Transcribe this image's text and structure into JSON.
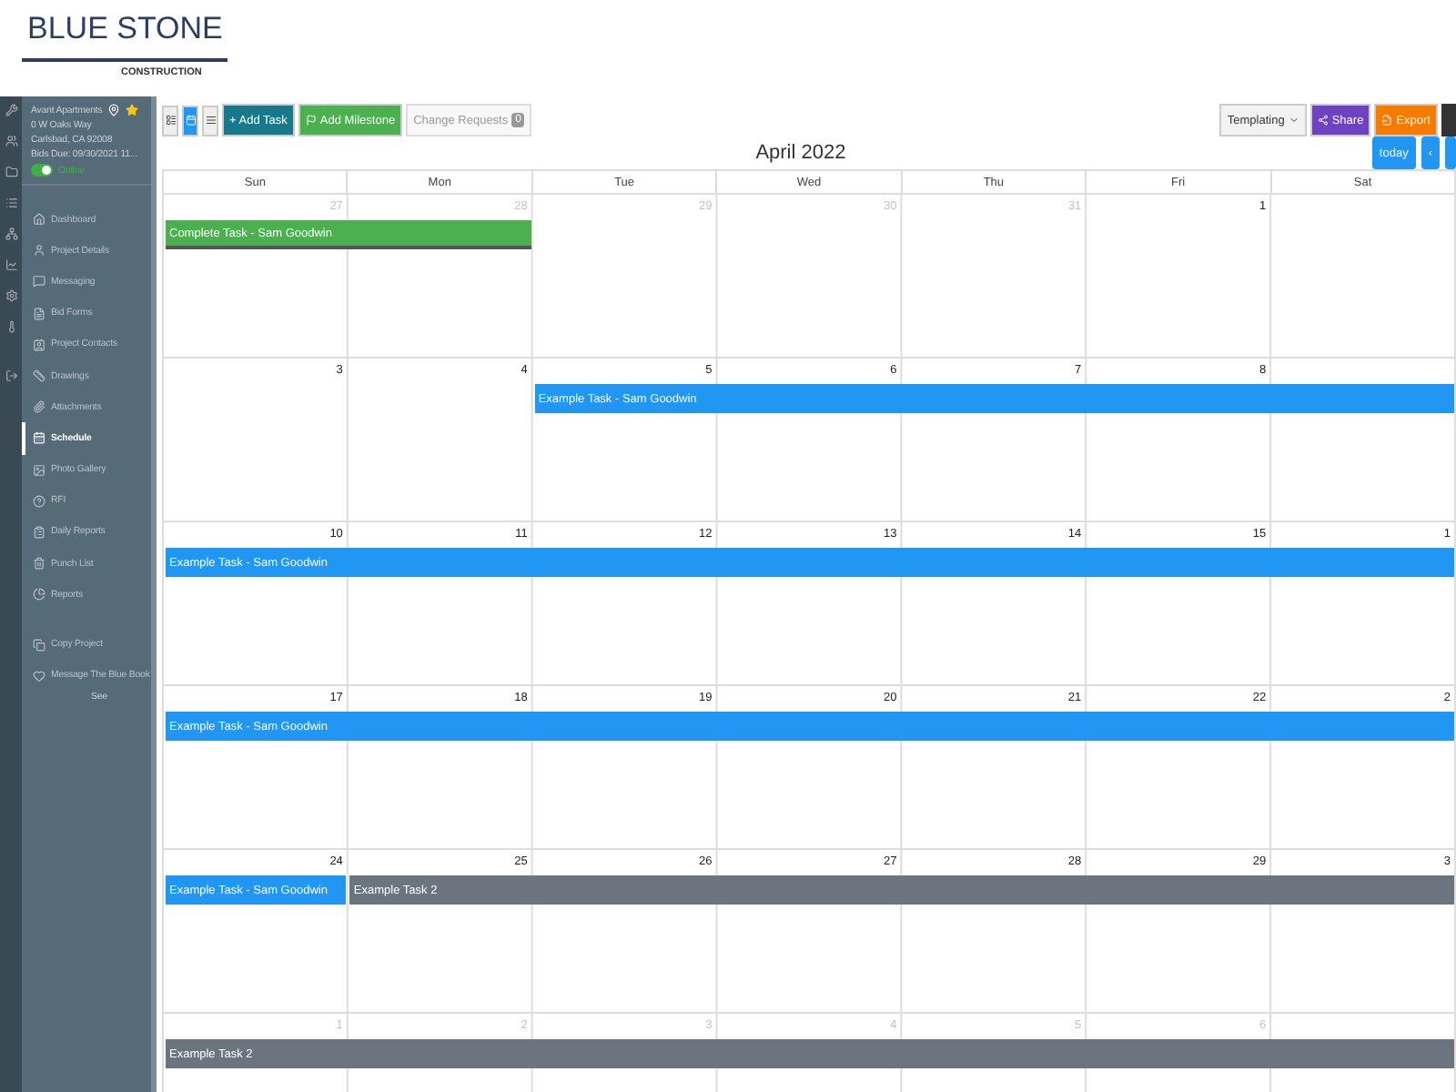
{
  "logo": {
    "name": "BLUE STONE",
    "tagline": "CONSTRUCTION"
  },
  "project": {
    "name": "Avant Apartments",
    "address": "0 W Oaks Way",
    "city": "Carlsbad, CA 92008",
    "bids_due": "Bids Due: 09/30/2021 11...",
    "status": {
      "label": "Online",
      "on": true
    }
  },
  "nav": [
    {
      "label": "Dashboard",
      "selected": false
    },
    {
      "label": "Project Details",
      "selected": false
    },
    {
      "label": "Messaging",
      "selected": false
    },
    {
      "label": "Bid Forms",
      "selected": false
    },
    {
      "label": "Project Contacts",
      "selected": false
    },
    {
      "label": "Drawings",
      "selected": false
    },
    {
      "label": "Attachments",
      "selected": false
    },
    {
      "label": "Schedule",
      "selected": true
    },
    {
      "label": "Photo Gallery",
      "selected": false
    },
    {
      "label": "RFI",
      "selected": false
    },
    {
      "label": "Daily Reports",
      "selected": false
    },
    {
      "label": "Punch List",
      "selected": false
    },
    {
      "label": "Reports",
      "selected": false
    }
  ],
  "nav_actions": [
    {
      "label": "Copy Project"
    },
    {
      "label": "Message The Blue Book",
      "note": "See"
    }
  ],
  "toolbar": {
    "views": [
      {
        "kind": "list",
        "selected": false
      },
      {
        "kind": "calendar",
        "selected": true
      },
      {
        "kind": "stack",
        "selected": false
      }
    ],
    "buttons": [
      {
        "kind": "add",
        "label": "+ Add Task"
      },
      {
        "kind": "milestone",
        "label": "Add Milestone"
      },
      {
        "kind": "requests",
        "label": "Change Requests",
        "badge": "0"
      }
    ],
    "right": [
      {
        "kind": "dropdown",
        "label": "Templating"
      },
      {
        "kind": "share",
        "label": "Share"
      },
      {
        "kind": "export",
        "label": "Export"
      }
    ]
  },
  "calendar": {
    "title": "April 2022",
    "today": "today",
    "prev": "‹",
    "weekdays": [
      "Sun",
      "Mon",
      "Tue",
      "Wed",
      "Thu",
      "Fri",
      "Sat"
    ],
    "weeks": [
      {
        "days": [
          {
            "date": "27",
            "muted": true,
            "bar": {
              "kind": "complete",
              "title": "Complete Task - Sam Goodwin"
            }
          },
          {
            "date": "28",
            "muted": true,
            "bar": {
              "kind": "complete"
            }
          },
          {
            "date": "29",
            "muted": true
          },
          {
            "date": "30",
            "muted": true
          },
          {
            "date": "31",
            "muted": true
          },
          {
            "date": "1",
            "muted": false
          }
        ]
      },
      {
        "days": [
          {
            "date": "3",
            "muted": false
          },
          {
            "date": "4",
            "muted": false
          },
          {
            "date": "5",
            "muted": false,
            "bar": {
              "kind": "task",
              "title": "Example Task - Sam Goodwin"
            }
          },
          {
            "date": "6",
            "muted": false,
            "bar": {
              "kind": "task"
            }
          },
          {
            "date": "7",
            "muted": false,
            "bar": {
              "kind": "task"
            }
          },
          {
            "date": "8",
            "muted": false,
            "bar": {
              "kind": "task"
            }
          },
          {
            "bar": {
              "kind": "task"
            }
          }
        ]
      },
      {
        "days": [
          {
            "date": "10",
            "muted": false,
            "bar": {
              "kind": "task",
              "title": "Example Task - Sam Goodwin"
            }
          },
          {
            "date": "11",
            "muted": false,
            "bar": {
              "kind": "task"
            }
          },
          {
            "date": "12",
            "muted": false,
            "bar": {
              "kind": "task"
            }
          },
          {
            "date": "13",
            "muted": false,
            "bar": {
              "kind": "task"
            }
          },
          {
            "date": "14",
            "muted": false,
            "bar": {
              "kind": "task"
            }
          },
          {
            "date": "15",
            "muted": false,
            "bar": {
              "kind": "task"
            }
          },
          {
            "date": "1",
            "muted": false,
            "bar": {
              "kind": "task"
            }
          }
        ]
      },
      {
        "days": [
          {
            "date": "17",
            "muted": false,
            "bar": {
              "kind": "task",
              "title": "Example Task - Sam Goodwin"
            }
          },
          {
            "date": "18",
            "muted": false,
            "bar": {
              "kind": "task"
            }
          },
          {
            "date": "19",
            "muted": false,
            "bar": {
              "kind": "task"
            }
          },
          {
            "date": "20",
            "muted": false,
            "bar": {
              "kind": "task"
            }
          },
          {
            "date": "21",
            "muted": false,
            "bar": {
              "kind": "task"
            }
          },
          {
            "date": "22",
            "muted": false,
            "bar": {
              "kind": "task"
            }
          },
          {
            "date": "2",
            "muted": false,
            "bar": {
              "kind": "task"
            }
          }
        ]
      },
      {
        "days": [
          {
            "date": "24",
            "muted": false,
            "bar": {
              "kind": "task",
              "title": "Example Task - Sam Goodwin"
            }
          },
          {
            "date": "25",
            "muted": false,
            "bar": {
              "kind": "other",
              "title": "Example Task 2"
            }
          },
          {
            "date": "26",
            "muted": false,
            "bar": {
              "kind": "other"
            }
          },
          {
            "date": "27",
            "muted": false,
            "bar": {
              "kind": "other"
            }
          },
          {
            "date": "28",
            "muted": false,
            "bar": {
              "kind": "other"
            }
          },
          {
            "date": "29",
            "muted": false,
            "bar": {
              "kind": "other"
            }
          },
          {
            "date": "3",
            "muted": false,
            "bar": {
              "kind": "other"
            }
          }
        ]
      },
      {
        "days": [
          {
            "date": "1",
            "muted": true,
            "bar": {
              "kind": "other",
              "title": "Example Task 2"
            }
          },
          {
            "date": "2",
            "muted": true,
            "bar": {
              "kind": "other"
            }
          },
          {
            "date": "3",
            "muted": true,
            "bar": {
              "kind": "other"
            }
          },
          {
            "date": "4",
            "muted": true,
            "bar": {
              "kind": "other"
            }
          },
          {
            "date": "5",
            "muted": true,
            "bar": {
              "kind": "other"
            }
          },
          {
            "date": "6",
            "muted": true,
            "bar": {
              "kind": "other"
            }
          },
          {
            "bar": {
              "kind": "other"
            }
          }
        ]
      }
    ]
  }
}
